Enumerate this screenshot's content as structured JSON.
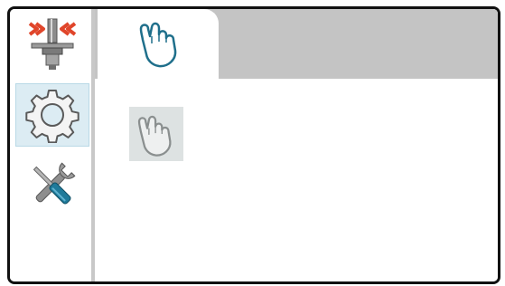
{
  "sidebar": {
    "items": [
      {
        "icon": "press-fit-icon",
        "active": false
      },
      {
        "icon": "gear-icon",
        "active": true
      },
      {
        "icon": "tools-icon",
        "active": false
      }
    ]
  },
  "tabs": [
    {
      "icon": "hand-pointer-icon",
      "label": "",
      "active": true
    }
  ],
  "main": {
    "tile_icon": "hand-pointer-icon"
  },
  "colors": {
    "tab_strip": "#c4c4c4",
    "active_sidebar_bg": "#dcecf3",
    "hand_stroke": "#1f6f8b",
    "hand_fill": "#ffffff",
    "tile_hand_stroke": "#8a8f8f",
    "gear_stroke": "#5a5a5a",
    "arrow_red": "#e0452a",
    "wrench_blue": "#1f7a9a"
  }
}
